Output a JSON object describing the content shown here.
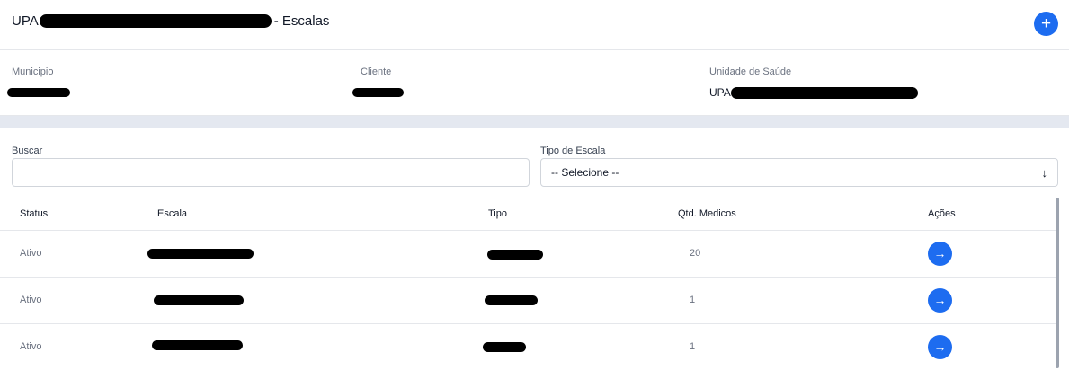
{
  "header": {
    "title_prefix": "UPA",
    "title_suffix": "- Escalas",
    "add_icon": "plus-icon"
  },
  "info": {
    "municipio_label": "Municipio",
    "cliente_label": "Cliente",
    "unidade_label": "Unidade de Saúde",
    "unidade_prefix": "UPA"
  },
  "filters": {
    "buscar_label": "Buscar",
    "buscar_value": "",
    "tipo_label": "Tipo de Escala",
    "tipo_selected": "-- Selecione --",
    "tipo_icon": "arrow-down-icon"
  },
  "table": {
    "columns": [
      "Status",
      "Escala",
      "Tipo",
      "Qtd. Medicos",
      "Ações"
    ],
    "rows": [
      {
        "status": "Ativo",
        "qtd": "20"
      },
      {
        "status": "Ativo",
        "qtd": "1"
      },
      {
        "status": "Ativo",
        "qtd": "1"
      }
    ],
    "action_icon": "arrow-right-icon"
  },
  "colors": {
    "accent": "#1d6cf0",
    "band": "#e4e8f0"
  }
}
